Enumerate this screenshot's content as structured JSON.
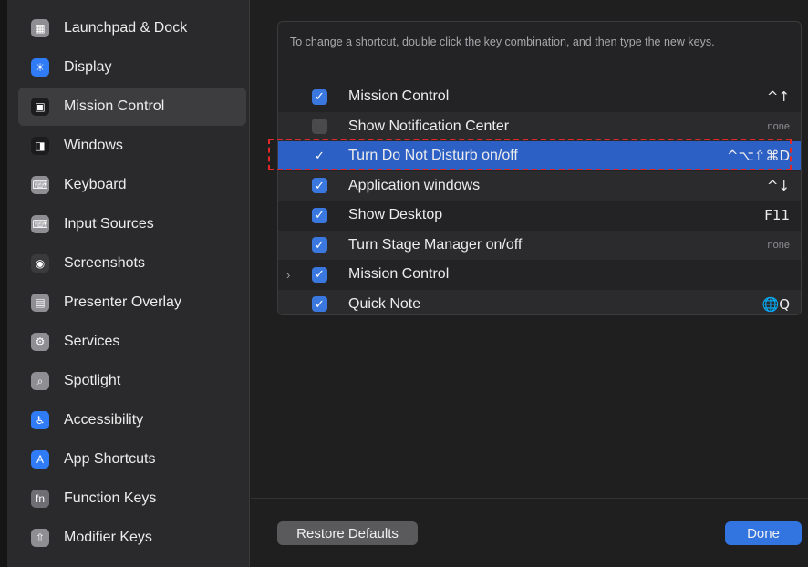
{
  "sidebar": {
    "items": [
      {
        "label": "Launchpad & Dock",
        "icon": "launchpad-icon",
        "color": "#8e8e93",
        "selected": false
      },
      {
        "label": "Display",
        "icon": "display-icon",
        "color": "#2f7cf6",
        "selected": false
      },
      {
        "label": "Mission Control",
        "icon": "mission-control-icon",
        "color": "#1c1c1e",
        "selected": true
      },
      {
        "label": "Windows",
        "icon": "windows-icon",
        "color": "#1c1c1e",
        "selected": false
      },
      {
        "label": "Keyboard",
        "icon": "keyboard-icon",
        "color": "#8e8e93",
        "selected": false
      },
      {
        "label": "Input Sources",
        "icon": "input-sources-icon",
        "color": "#8e8e93",
        "selected": false
      },
      {
        "label": "Screenshots",
        "icon": "screenshots-icon",
        "color": "#3a3a3c",
        "selected": false
      },
      {
        "label": "Presenter Overlay",
        "icon": "presenter-overlay-icon",
        "color": "#8e8e93",
        "selected": false
      },
      {
        "label": "Services",
        "icon": "services-icon",
        "color": "#8e8e93",
        "selected": false
      },
      {
        "label": "Spotlight",
        "icon": "spotlight-icon",
        "color": "#8e8e93",
        "selected": false
      },
      {
        "label": "Accessibility",
        "icon": "accessibility-icon",
        "color": "#2f7cf6",
        "selected": false
      },
      {
        "label": "App Shortcuts",
        "icon": "app-shortcuts-icon",
        "color": "#2f7cf6",
        "selected": false
      },
      {
        "label": "Function Keys",
        "icon": "function-keys-icon",
        "color": "#6e6e73",
        "selected": false
      },
      {
        "label": "Modifier Keys",
        "icon": "modifier-keys-icon",
        "color": "#8e8e93",
        "selected": false
      }
    ]
  },
  "main": {
    "instructions": "To change a shortcut, double click the key combination, and then type the new keys.",
    "rows": [
      {
        "label": "Mission Control",
        "checked": true,
        "shortcut": "^↑",
        "has_chevron": false
      },
      {
        "label": "Show Notification Center",
        "checked": false,
        "shortcut": "none",
        "has_chevron": false
      },
      {
        "label": "Turn Do Not Disturb on/off",
        "checked": true,
        "shortcut": "^⌥⇧⌘D",
        "has_chevron": false,
        "selected": true
      },
      {
        "label": "Application windows",
        "checked": true,
        "shortcut": "^↓",
        "has_chevron": false
      },
      {
        "label": "Show Desktop",
        "checked": true,
        "shortcut": "F11",
        "has_chevron": false
      },
      {
        "label": "Turn Stage Manager on/off",
        "checked": true,
        "shortcut": "none",
        "has_chevron": false
      },
      {
        "label": "Mission Control",
        "checked": true,
        "shortcut": "",
        "has_chevron": true
      },
      {
        "label": "Quick Note",
        "checked": true,
        "shortcut": "🌐Q",
        "has_chevron": false
      }
    ],
    "restore_label": "Restore Defaults",
    "done_label": "Done"
  },
  "colors": {
    "accent": "#3274e0",
    "selection": "#2d60c5",
    "highlight_box": "#e02828"
  }
}
